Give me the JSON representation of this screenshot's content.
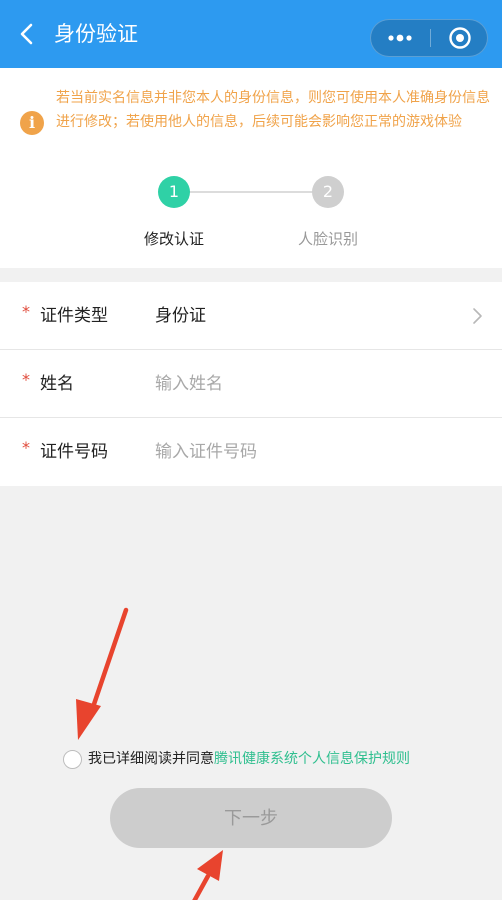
{
  "colors": {
    "navbar": "#2d9af0",
    "warning": "#f0a34a",
    "step_active": "#2fd1a6",
    "step_inactive": "#cfcfcf",
    "required": "#e04a3a",
    "link": "#2fbf8f",
    "arrow": "#e8442e",
    "disabled_button": "#cdcdcd"
  },
  "navbar": {
    "title": "身份验证",
    "back_icon": "chevron-left-icon",
    "more_icon": "more-dots-icon",
    "close_icon": "target-close-icon"
  },
  "notice": {
    "icon": "info-icon",
    "icon_glyph": "i",
    "text": "若当前实名信息并非您本人的身份信息，则您可使用本人准确身份信息进行修改；若使用他人的信息，后续可能会影响您正常的游戏体验"
  },
  "steps": [
    {
      "number": "1",
      "label": "修改认证",
      "active": true
    },
    {
      "number": "2",
      "label": "人脸识别",
      "active": false
    }
  ],
  "form": {
    "id_type": {
      "required_mark": "*",
      "label": "证件类型",
      "value": "身份证"
    },
    "name": {
      "required_mark": "*",
      "label": "姓名",
      "placeholder": "输入姓名",
      "value": ""
    },
    "id_number": {
      "required_mark": "*",
      "label": "证件号码",
      "placeholder": "输入证件号码",
      "value": ""
    }
  },
  "agreement": {
    "checked": false,
    "text": "我已详细阅读并同意",
    "link": "腾讯健康系统个人信息保护规则"
  },
  "next_button": {
    "label": "下一步",
    "enabled": false
  }
}
